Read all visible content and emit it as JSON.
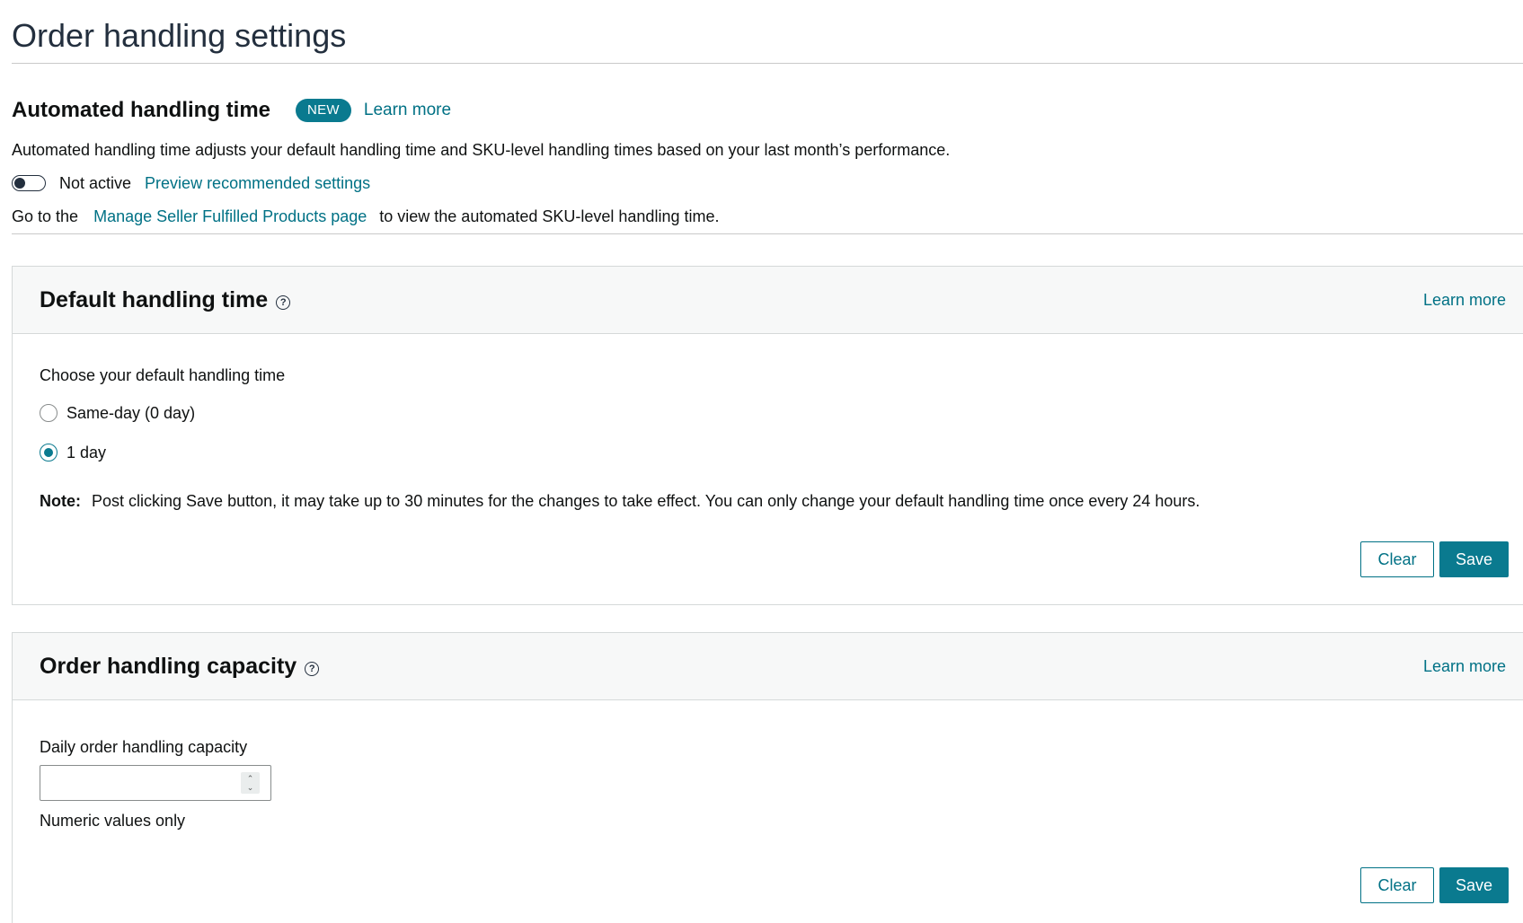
{
  "page": {
    "title": "Order handling settings"
  },
  "automated": {
    "title": "Automated handling time",
    "badge": "NEW",
    "learn_more": "Learn more",
    "description": "Automated handling time adjusts your default handling time and SKU-level handling times based on your last month’s performance.",
    "toggle_status": "Not active",
    "preview_link": "Preview recommended settings",
    "goto_prefix": "Go to the",
    "goto_link": "Manage Seller Fulfilled Products page",
    "goto_suffix": "to view the automated SKU-level handling time."
  },
  "default_handling": {
    "title": "Default handling time",
    "help_icon": "?",
    "learn_more": "Learn more",
    "choose_label": "Choose your default handling time",
    "options": [
      {
        "label": "Same-day (0 day)",
        "checked": false
      },
      {
        "label": "1 day",
        "checked": true
      }
    ],
    "note_label": "Note:",
    "note_text": "Post clicking Save button, it may take up to 30 minutes for the changes to take effect. You can only change your default handling time once every 24 hours.",
    "clear_label": "Clear",
    "save_label": "Save"
  },
  "capacity": {
    "title": "Order handling capacity",
    "help_icon": "?",
    "learn_more": "Learn more",
    "field_label": "Daily order handling capacity",
    "field_value": "",
    "hint": "Numeric values only",
    "clear_label": "Clear",
    "save_label": "Save"
  },
  "icons": {
    "help": "help-circle-icon",
    "spinner_up": "chevron-up-icon",
    "spinner_down": "chevron-down-icon"
  },
  "colors": {
    "accent": "#0a7a8f",
    "link": "#007185",
    "heading": "#232f3e",
    "card_header_bg": "#f7f8f8",
    "border": "#d5d9d9"
  }
}
